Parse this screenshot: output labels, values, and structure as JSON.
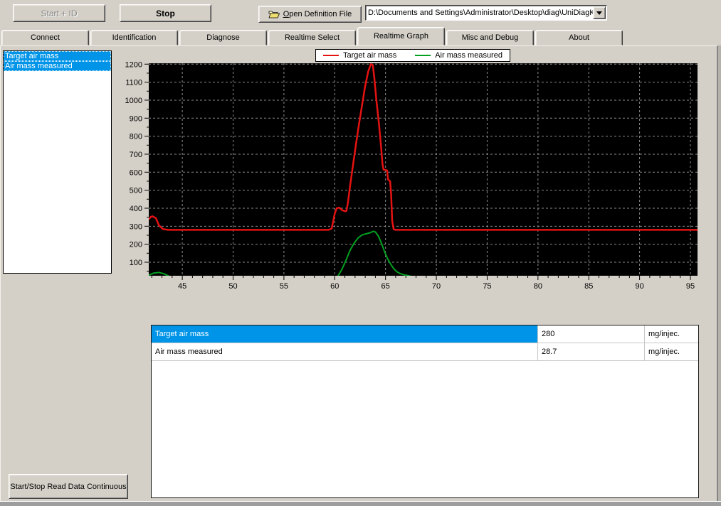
{
  "toolbar": {
    "start_id_label": "Start + ID",
    "stop_label": "Stop",
    "open_def_first": "O",
    "open_def_rest": "pen Definition File",
    "path_value": "D:\\Documents and Settings\\Administrator\\Desktop\\diag\\UniDiagK"
  },
  "tabs": [
    {
      "label": "Connect",
      "active": false
    },
    {
      "label": "Identification",
      "active": false
    },
    {
      "label": "Diagnose",
      "active": false
    },
    {
      "label": "Realtime Select",
      "active": false
    },
    {
      "label": "Realtime Graph",
      "active": true
    },
    {
      "label": "Misc and Debug",
      "active": false
    },
    {
      "label": "About",
      "active": false
    }
  ],
  "signal_list": [
    "Target air mass",
    "Air mass measured"
  ],
  "chart_data": {
    "type": "line",
    "title": "",
    "xlabel": "",
    "ylabel": "",
    "xlim": [
      41.7,
      95.7
    ],
    "ylim": [
      25,
      1205
    ],
    "x_major_ticks": [
      45,
      50,
      55,
      60,
      65,
      70,
      75,
      80,
      85,
      90,
      95
    ],
    "x_minor_step": 1,
    "y_major_ticks": [
      100,
      200,
      300,
      400,
      500,
      600,
      700,
      800,
      900,
      1000,
      1100,
      1200
    ],
    "y_minor_step": 50,
    "grid": "dashed",
    "plot_bg": "#000000",
    "grid_color": "#8c8c8c",
    "legend_position": "top",
    "series": [
      {
        "name": "Target air mass",
        "color": "#e51212",
        "points": [
          [
            41.7,
            338
          ],
          [
            41.9,
            352
          ],
          [
            42.1,
            355
          ],
          [
            42.4,
            345
          ],
          [
            42.7,
            305
          ],
          [
            43.1,
            284
          ],
          [
            43.6,
            280
          ],
          [
            59.4,
            280
          ],
          [
            59.7,
            287
          ],
          [
            60.0,
            370
          ],
          [
            60.2,
            400
          ],
          [
            60.45,
            403
          ],
          [
            60.7,
            390
          ],
          [
            61.0,
            383
          ],
          [
            61.15,
            385
          ],
          [
            61.3,
            430
          ],
          [
            61.5,
            520
          ],
          [
            61.8,
            640
          ],
          [
            62.1,
            760
          ],
          [
            62.4,
            870
          ],
          [
            62.7,
            975
          ],
          [
            63.0,
            1080
          ],
          [
            63.3,
            1160
          ],
          [
            63.55,
            1200
          ],
          [
            63.75,
            1195
          ],
          [
            63.9,
            1120
          ],
          [
            64.1,
            1000
          ],
          [
            64.35,
            870
          ],
          [
            64.55,
            750
          ],
          [
            64.7,
            645
          ],
          [
            64.8,
            615
          ],
          [
            65.15,
            610
          ],
          [
            65.25,
            560
          ],
          [
            65.45,
            550
          ],
          [
            65.55,
            480
          ],
          [
            65.65,
            330
          ],
          [
            65.8,
            283
          ],
          [
            66.0,
            280
          ],
          [
            95.7,
            280
          ]
        ]
      },
      {
        "name": "Air mass measured",
        "color": "#00a020",
        "points": [
          [
            41.7,
            28
          ],
          [
            42.2,
            40
          ],
          [
            42.7,
            43
          ],
          [
            43.2,
            36
          ],
          [
            43.7,
            22
          ],
          [
            44.1,
            12
          ],
          [
            59.9,
            12
          ],
          [
            60.3,
            22
          ],
          [
            60.7,
            60
          ],
          [
            61.1,
            110
          ],
          [
            61.5,
            165
          ],
          [
            61.9,
            205
          ],
          [
            62.3,
            235
          ],
          [
            62.7,
            252
          ],
          [
            63.1,
            258
          ],
          [
            63.5,
            264
          ],
          [
            63.8,
            272
          ],
          [
            64.0,
            268
          ],
          [
            64.3,
            245
          ],
          [
            64.6,
            205
          ],
          [
            64.9,
            160
          ],
          [
            65.2,
            120
          ],
          [
            65.5,
            90
          ],
          [
            65.8,
            65
          ],
          [
            66.1,
            48
          ],
          [
            66.4,
            38
          ],
          [
            66.8,
            30
          ],
          [
            67.2,
            26
          ],
          [
            67.6,
            20
          ],
          [
            68.1,
            16
          ],
          [
            68.6,
            12
          ]
        ]
      }
    ]
  },
  "values_table": {
    "rows": [
      {
        "name": "Target air mass",
        "value": "280",
        "unit": "mg/injec.",
        "selected": true
      },
      {
        "name": "Air mass measured",
        "value": "28.7",
        "unit": "mg/injec.",
        "selected": false
      }
    ]
  },
  "bottom": {
    "continuous_label": "Start/Stop Read Data Continuous"
  },
  "colors": {
    "selection": "#0094e8",
    "window_bg": "#d4d0c8"
  }
}
